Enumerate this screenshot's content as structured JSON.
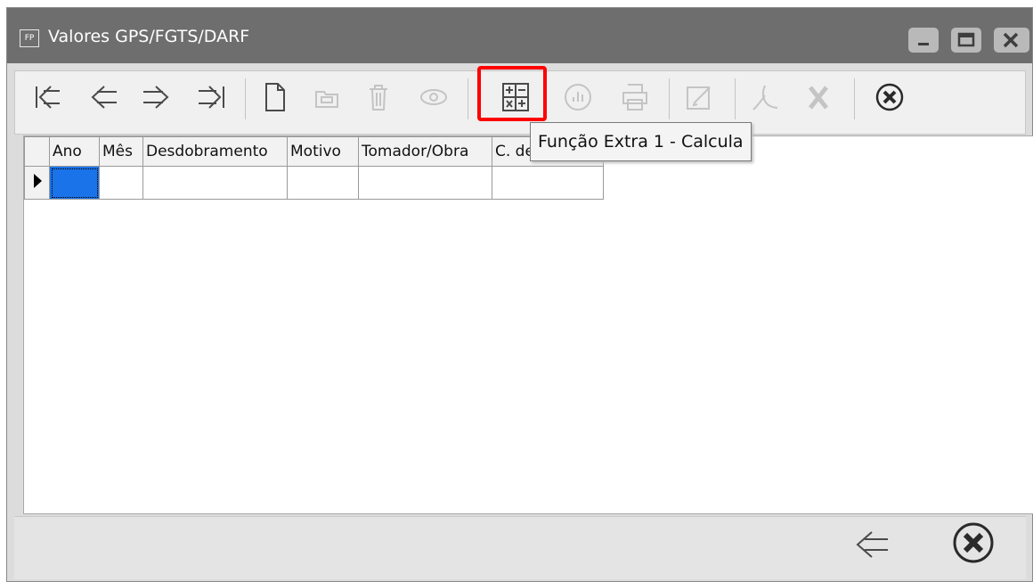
{
  "window": {
    "app_badge": "FP",
    "title": "Valores GPS/FGTS/DARF"
  },
  "toolbar": {
    "tooltip": "Função Extra 1 - Calcula",
    "buttons": [
      {
        "name": "first-record",
        "icon": "first-arrow-icon",
        "enabled": true
      },
      {
        "name": "previous-record",
        "icon": "left-arrow-icon",
        "enabled": true
      },
      {
        "name": "next-record",
        "icon": "right-arrow-icon",
        "enabled": true
      },
      {
        "name": "last-record",
        "icon": "last-arrow-icon",
        "enabled": true
      },
      {
        "name": "new",
        "icon": "new-document-icon",
        "enabled": true
      },
      {
        "name": "edit",
        "icon": "folder-icon",
        "enabled": false
      },
      {
        "name": "delete",
        "icon": "trash-icon",
        "enabled": false
      },
      {
        "name": "view",
        "icon": "eye-icon",
        "enabled": false
      },
      {
        "name": "calculate",
        "icon": "calculator-icon",
        "enabled": true,
        "highlighted": true
      },
      {
        "name": "report",
        "icon": "chart-icon",
        "enabled": false
      },
      {
        "name": "print",
        "icon": "printer-icon",
        "enabled": false
      },
      {
        "name": "edit-text",
        "icon": "pencil-icon",
        "enabled": false
      },
      {
        "name": "pdf",
        "icon": "pdf-icon",
        "enabled": false
      },
      {
        "name": "excel",
        "icon": "excel-icon",
        "enabled": false
      },
      {
        "name": "close",
        "icon": "close-circle-icon",
        "enabled": true
      }
    ]
  },
  "grid": {
    "columns": [
      "Ano",
      "Mês",
      "Desdobramento",
      "Motivo",
      "Tomador/Obra",
      "C. de Custo"
    ],
    "rows": [
      [
        "",
        "",
        "",
        "",
        "",
        ""
      ]
    ]
  },
  "footer": {
    "back_icon": "left-arrow-icon",
    "close_icon": "close-circle-icon"
  },
  "colors": {
    "titlebar": "#6e6e6e",
    "highlight": "#ff0000",
    "selected_cell": "#1a73e8"
  }
}
